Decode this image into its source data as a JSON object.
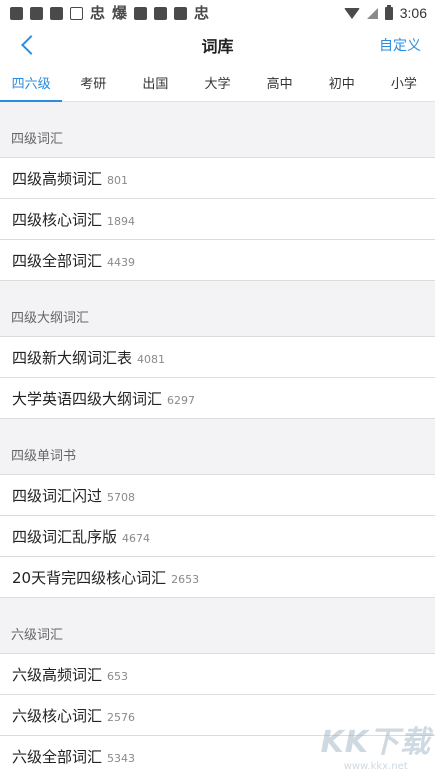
{
  "status_bar": {
    "glyph_a": "忠",
    "glyph_b": "爆",
    "glyph_c": "忠",
    "time": "3:06",
    "icons": [
      "notification-icon",
      "app-icon",
      "app-icon",
      "app-icon",
      "wifi-icon",
      "signal-icon",
      "battery-icon"
    ]
  },
  "header": {
    "title": "词库",
    "action": "自定义",
    "back_icon": "chevron-left-icon"
  },
  "tabs": [
    {
      "label": "四六级",
      "active": true
    },
    {
      "label": "考研"
    },
    {
      "label": "出国"
    },
    {
      "label": "大学"
    },
    {
      "label": "高中"
    },
    {
      "label": "初中"
    },
    {
      "label": "小学"
    }
  ],
  "sections": [
    {
      "title": "四级词汇",
      "items": [
        {
          "title": "四级高频词汇",
          "count": "801"
        },
        {
          "title": "四级核心词汇",
          "count": "1894"
        },
        {
          "title": "四级全部词汇",
          "count": "4439"
        }
      ]
    },
    {
      "title": "四级大纲词汇",
      "items": [
        {
          "title": "四级新大纲词汇表",
          "count": "4081"
        },
        {
          "title": "大学英语四级大纲词汇",
          "count": "6297"
        }
      ]
    },
    {
      "title": "四级单词书",
      "items": [
        {
          "title": "四级词汇闪过",
          "count": "5708"
        },
        {
          "title": "四级词汇乱序版",
          "count": "4674"
        },
        {
          "title": "20天背完四级核心词汇",
          "count": "2653"
        }
      ]
    },
    {
      "title": "六级词汇",
      "items": [
        {
          "title": "六级高频词汇",
          "count": "653"
        },
        {
          "title": "六级核心词汇",
          "count": "2576"
        },
        {
          "title": "六级全部词汇",
          "count": "5343"
        }
      ]
    }
  ],
  "watermark": {
    "logo": "KK下载",
    "url": "www.kkx.net"
  },
  "colors": {
    "accent": "#2a8de0",
    "section_bg": "#f3f3f5",
    "divider": "#dcdcdc"
  }
}
